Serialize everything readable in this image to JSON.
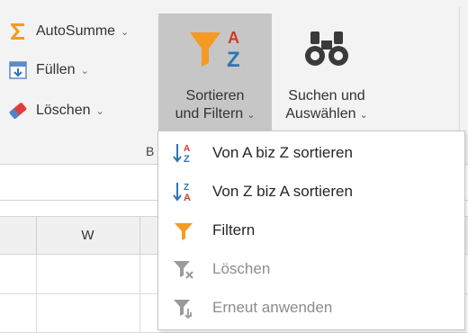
{
  "ribbon": {
    "autosum": {
      "label": "AutoSumme",
      "icon": "sigma-icon"
    },
    "fill": {
      "label": "Füllen",
      "icon": "fill-down-icon"
    },
    "clear": {
      "label": "Löschen",
      "icon": "eraser-icon"
    },
    "sort_filter": {
      "line1": "Sortieren",
      "line2": "und Filtern",
      "icon": "sort-filter-icon"
    },
    "find_select": {
      "line1": "Suchen und",
      "line2": "Auswählen",
      "icon": "binoculars-icon"
    },
    "group_label": "B"
  },
  "sheet": {
    "column_label": "W"
  },
  "menu": {
    "items": [
      {
        "label": "Von A biz Z sortieren",
        "icon": "sort-a-to-z-icon",
        "enabled": true
      },
      {
        "label": "Von Z biz A sortieren",
        "icon": "sort-z-to-a-icon",
        "enabled": true
      },
      {
        "label": "Filtern",
        "icon": "filter-icon",
        "enabled": true
      },
      {
        "label": "Löschen",
        "icon": "clear-filter-icon",
        "enabled": false
      },
      {
        "label": "Erneut anwenden",
        "icon": "reapply-filter-icon",
        "enabled": false
      }
    ]
  },
  "colors": {
    "accent_orange": "#f59a23",
    "accent_blue": "#2e75b6",
    "sort_letter_red": "#d23a2a",
    "selected_button_bg": "#c6c6c6",
    "disabled_gray": "#8c8c8c"
  }
}
